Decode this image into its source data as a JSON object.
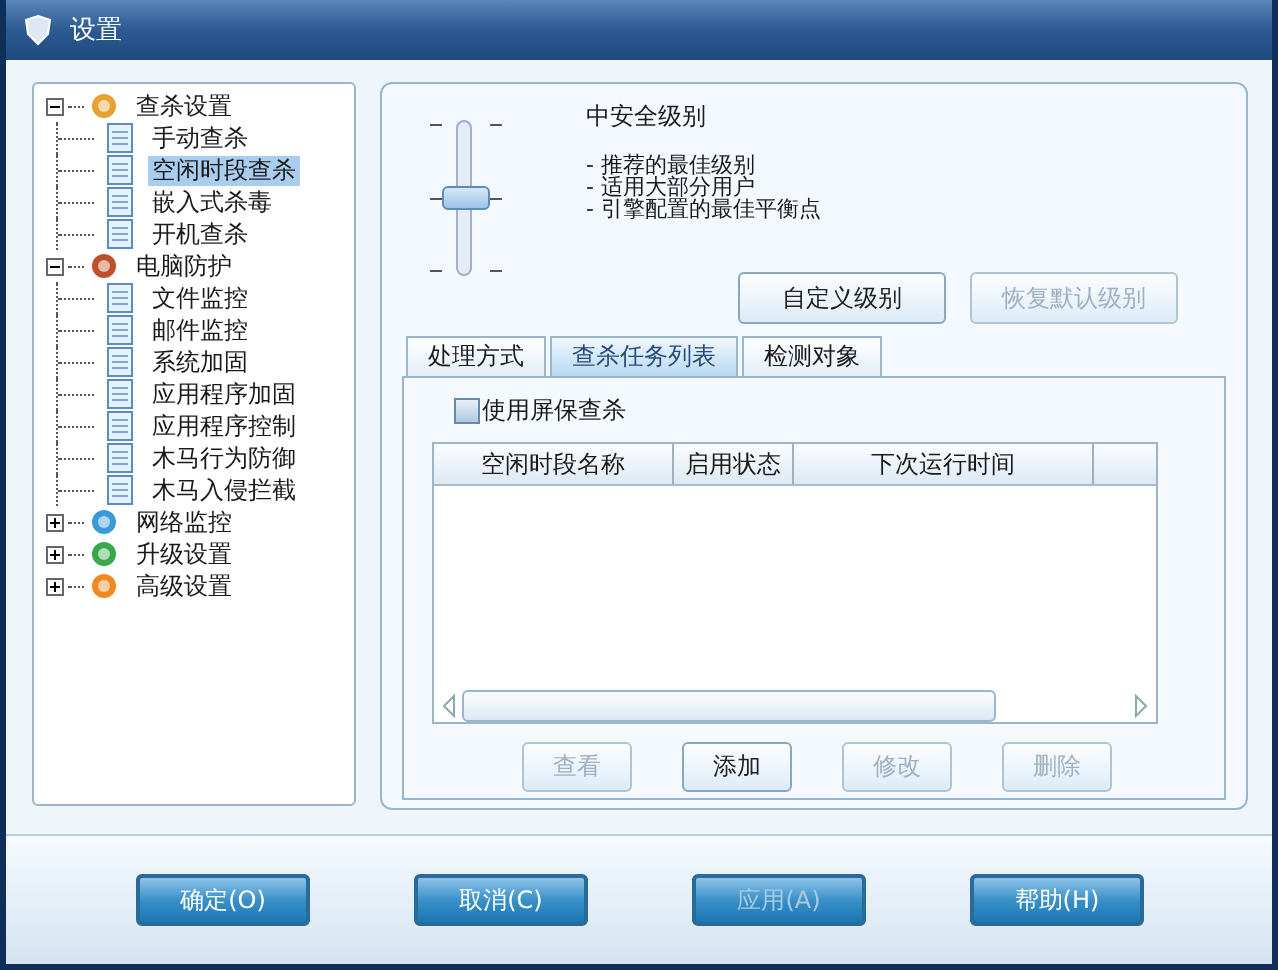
{
  "window": {
    "title": "设置"
  },
  "tree": [
    {
      "label": "查杀设置",
      "expanded": true,
      "selected": false,
      "children": [
        {
          "label": "手动查杀",
          "selected": false
        },
        {
          "label": "空闲时段查杀",
          "selected": true
        },
        {
          "label": "嵌入式杀毒",
          "selected": false
        },
        {
          "label": "开机查杀",
          "selected": false
        }
      ]
    },
    {
      "label": "电脑防护",
      "expanded": true,
      "selected": false,
      "children": [
        {
          "label": "文件监控",
          "selected": false
        },
        {
          "label": "邮件监控",
          "selected": false
        },
        {
          "label": "系统加固",
          "selected": false
        },
        {
          "label": "应用程序加固",
          "selected": false
        },
        {
          "label": "应用程序控制",
          "selected": false
        },
        {
          "label": "木马行为防御",
          "selected": false
        },
        {
          "label": "木马入侵拦截",
          "selected": false
        }
      ]
    },
    {
      "label": "网络监控",
      "expanded": false,
      "selected": false
    },
    {
      "label": "升级设置",
      "expanded": false,
      "selected": false
    },
    {
      "label": "高级设置",
      "expanded": false,
      "selected": false
    }
  ],
  "security_level": {
    "level": 0.5,
    "title": "中安全级别",
    "points": [
      "- 推荐的最佳级别",
      "- 适用大部分用户",
      "- 引擎配置的最佳平衡点"
    ]
  },
  "level_buttons": [
    {
      "label": "自定义级别",
      "disabled": false
    },
    {
      "label": "恢复默认级别",
      "disabled": true
    }
  ],
  "tabs": [
    {
      "label": "处理方式",
      "selected": false
    },
    {
      "label": "查杀任务列表",
      "selected": true
    },
    {
      "label": "检测对象",
      "selected": false
    }
  ],
  "screensaver_checkbox": {
    "label": "使用屏保查杀",
    "checked": false
  },
  "table": {
    "columns": [
      "空闲时段名称",
      "启用状态",
      "下次运行时间"
    ]
  },
  "table_buttons": [
    {
      "label": "查看",
      "disabled": true
    },
    {
      "label": "添加",
      "disabled": false
    },
    {
      "label": "修改",
      "disabled": true
    },
    {
      "label": "删除",
      "disabled": true
    }
  ],
  "dialog_buttons": [
    {
      "label": "确定(O)",
      "disabled": false
    },
    {
      "label": "取消(C)",
      "disabled": false
    },
    {
      "label": "应用(A)",
      "disabled": true
    },
    {
      "label": "帮助(H)",
      "disabled": false
    }
  ]
}
